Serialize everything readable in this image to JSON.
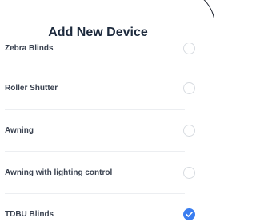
{
  "header": {
    "title": "Add New Device"
  },
  "device_options": [
    {
      "label": "Zebra Blinds",
      "selected": false
    },
    {
      "label": "Roller Shutter",
      "selected": false
    },
    {
      "label": "Awning",
      "selected": false
    },
    {
      "label": "Awning with lighting control",
      "selected": false
    },
    {
      "label": "TDBU Blinds",
      "selected": true
    }
  ],
  "colors": {
    "title": "#1d2a3d",
    "label": "#3a4250",
    "radio_border": "#d7dbe0",
    "radio_selected": "#3b7ef0"
  },
  "icons": {
    "selected_indicator": "checkmark-icon"
  }
}
